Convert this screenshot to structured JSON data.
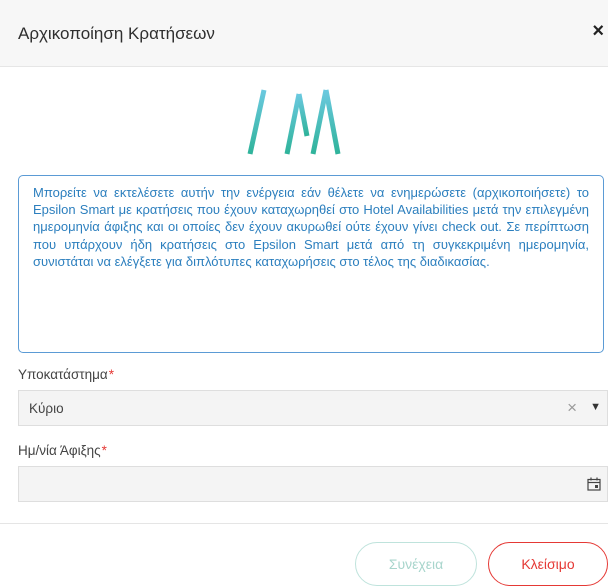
{
  "dialog": {
    "title": "Αρχικοποίηση Κρατήσεων",
    "close_symbol": "×"
  },
  "logo": {
    "icon": "haa-logo",
    "color": "#3cb8a6"
  },
  "info": {
    "text": "Μπορείτε να εκτελέσετε αυτήν την ενέργεια εάν θέλετε να ενημερώσετε (αρχικοποιήσετε) το Epsilon Smart με κρατήσεις που έχουν καταχωρηθεί στο Hotel Availabilities μετά την επιλεγμένη ημερομηνία άφιξης και οι οποίες δεν έχουν ακυρωθεί ούτε έχουν γίνει check out. Σε περίπτωση που υπάρχουν ήδη κρατήσεις στο Epsilon Smart μετά από τη συγκεκριμένη ημερομηνία, συνιστάται να ελέγξετε για διπλότυπες καταχωρήσεις στο τέλος της διαδικασίας.",
    "color": "#2c7fbe"
  },
  "form": {
    "branch": {
      "label": "Υποκατάστημα",
      "required_mark": "*",
      "value": "Κύριο",
      "clear_symbol": "×",
      "caret_symbol": "▼"
    },
    "arrival_date": {
      "label": "Ημ/νία Άφιξης",
      "required_mark": "*",
      "value": "",
      "icon": "calendar-icon"
    }
  },
  "buttons": {
    "continue": "Συνέχεια",
    "close": "Κλείσιμο"
  },
  "colors": {
    "accent_red": "#e53935",
    "accent_teal": "#3cb8a6",
    "info_blue": "#5b9bd5"
  }
}
